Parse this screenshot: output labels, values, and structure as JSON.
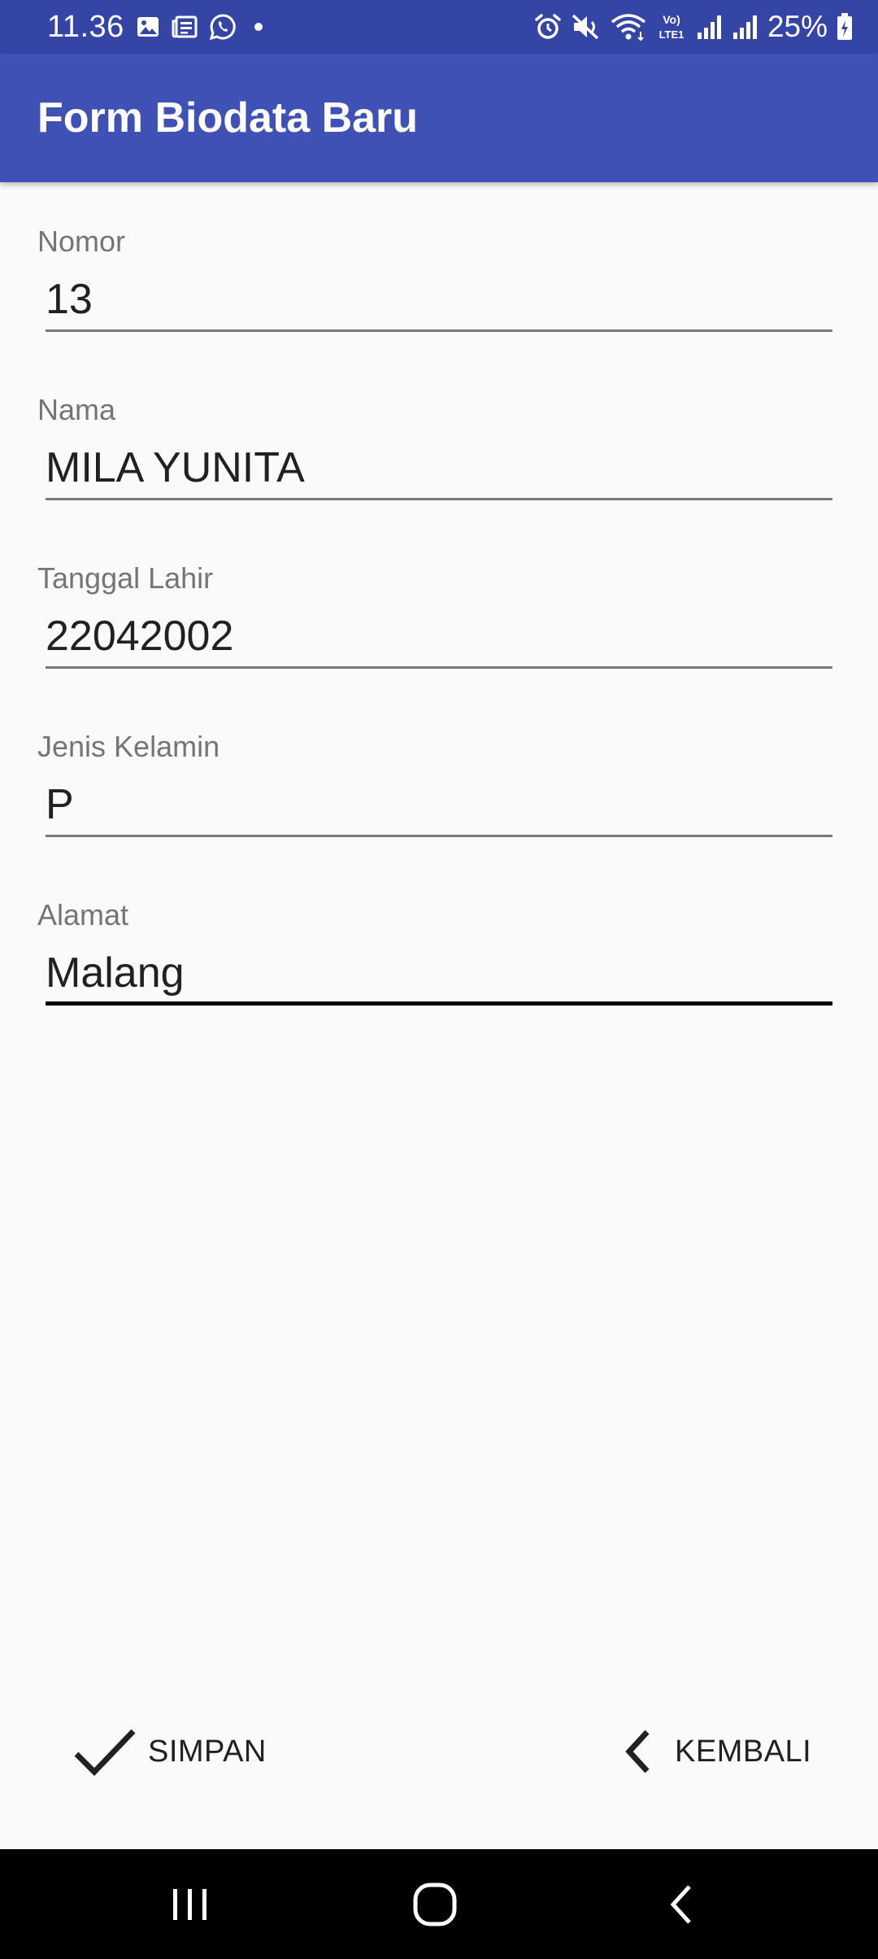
{
  "status_bar": {
    "time": "11.36",
    "battery": "25%",
    "notification_icons": [
      "gallery-icon",
      "news-icon",
      "whatsapp-icon",
      "dot-icon"
    ],
    "system_icons": [
      "alarm-icon",
      "mute-icon",
      "wifi-icon",
      "volte-icon",
      "signal-icon",
      "signal-icon",
      "battery-charging-icon"
    ],
    "volte_label": "Vo) LTE1"
  },
  "app_bar": {
    "title": "Form Biodata Baru"
  },
  "form": {
    "fields": [
      {
        "label": "Nomor",
        "value": "13"
      },
      {
        "label": "Nama",
        "value": "MILA YUNITA"
      },
      {
        "label": "Tanggal Lahir",
        "value": "22042002"
      },
      {
        "label": "Jenis Kelamin",
        "value": "P"
      },
      {
        "label": "Alamat",
        "value": "Malang"
      }
    ]
  },
  "actions": {
    "save_label": "SIMPAN",
    "back_label": "KEMBALI",
    "save_icon": "check-icon",
    "back_icon": "chevron-left-icon"
  },
  "navigation": {
    "buttons": [
      "recents-icon",
      "home-icon",
      "back-icon"
    ]
  },
  "colors": {
    "status_bar": "#3445a6",
    "app_bar": "#3f51b5",
    "background": "#fafafa",
    "nav_bar": "#000000"
  }
}
